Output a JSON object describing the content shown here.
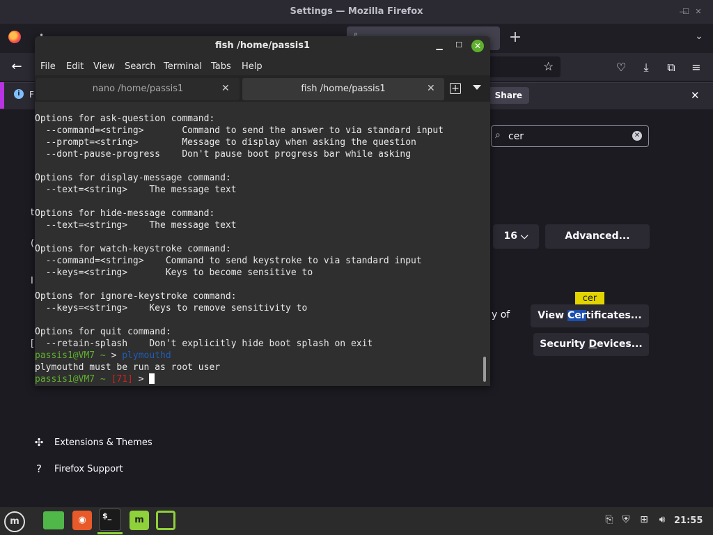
{
  "firefox": {
    "window_title": "Settings — Mozilla Firefox",
    "notification_letter": "F",
    "notification_button": "Share",
    "find_query": "cer",
    "font_size_value": "16",
    "advanced_label": "Advanced...",
    "view_certificates": {
      "pre": "View ",
      "hl": "Cer",
      "post": "tificates..."
    },
    "security_devices": {
      "pre": "Security ",
      "hl": "D",
      "post": "evices..."
    },
    "tooltip": "cer",
    "partial_text_of": "y of",
    "sidebar": [
      {
        "label": "Extensions & Themes",
        "icon": "puzzle-icon"
      },
      {
        "label": "Firefox Support",
        "icon": "help-icon"
      }
    ],
    "left_fragments": [
      "t",
      "(",
      "I",
      "["
    ]
  },
  "terminal": {
    "title": "fish /home/passis1",
    "menu": [
      "File",
      "Edit",
      "View",
      "Search",
      "Terminal",
      "Tabs",
      "Help"
    ],
    "tabs": [
      {
        "label": "nano /home/passis1",
        "active": false
      },
      {
        "label": "fish /home/passis1",
        "active": true
      }
    ],
    "lines": [
      "Options for ask-question command:",
      "  --command=<string>       Command to send the answer to via standard input",
      "  --prompt=<string>        Message to display when asking the question",
      "  --dont-pause-progress    Don't pause boot progress bar while asking",
      "",
      "Options for display-message command:",
      "  --text=<string>    The message text",
      "",
      "Options for hide-message command:",
      "  --text=<string>    The message text",
      "",
      "Options for watch-keystroke command:",
      "  --command=<string>    Command to send keystroke to via standard input",
      "  --keys=<string>       Keys to become sensitive to",
      "",
      "Options for ignore-keystroke command:",
      "  --keys=<string>    Keys to remove sensitivity to",
      "",
      "Options for quit command:",
      "  --retain-splash    Don't explicitly hide boot splash on exit"
    ],
    "prompt1": {
      "user": "passis1@VM7",
      "dir": " ~",
      "arrow": "> ",
      "cmd": "plymouthd"
    },
    "output": "plymouthd must be run as root user",
    "prompt2": {
      "user": "passis1@VM7",
      "dir": " ~",
      "err_code": "[71]",
      "arrow": " > "
    }
  },
  "taskbar": {
    "clock": "21:55",
    "terminal_icon_text": "$_"
  },
  "colors": {
    "prompt_green": "#5faf2f",
    "command_blue": "#1e5db8",
    "error_red": "#d71f1f",
    "find_tooltip": "#e3d400"
  }
}
